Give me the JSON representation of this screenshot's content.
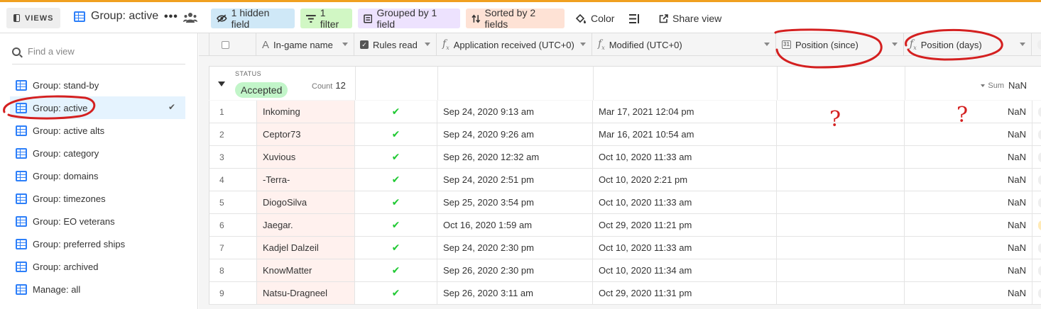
{
  "topbar": {
    "views_label": "VIEWS",
    "current_view": "Group: active",
    "more": "•••",
    "hidden_fields": "1 hidden field",
    "filter": "1 filter",
    "grouped": "Grouped by 1 field",
    "sorted": "Sorted by 2 fields",
    "color": "Color",
    "share": "Share view"
  },
  "sidebar": {
    "find_placeholder": "Find a view",
    "views": [
      {
        "label": "Group: stand-by"
      },
      {
        "label": "Group: active"
      },
      {
        "label": "Group: active alts"
      },
      {
        "label": "Group: category"
      },
      {
        "label": "Group: domains"
      },
      {
        "label": "Group: timezones"
      },
      {
        "label": "Group: EO veterans"
      },
      {
        "label": "Group: preferred ships"
      },
      {
        "label": "Group: archived"
      },
      {
        "label": "Manage: all"
      }
    ],
    "active_index": 1
  },
  "columns": {
    "name": "In-game name",
    "rules": "Rules read",
    "app": "Application received (UTC+0)",
    "mod": "Modified (UTC+0)",
    "since": "Position (since)",
    "days": "Position (days)",
    "since_icon": "31"
  },
  "group": {
    "field_label": "STATUS",
    "value": "Accepted",
    "badge_color": "#c2f5c9",
    "count_label": "Count",
    "count": "12",
    "sum_label": "Sum",
    "sum": "NaN"
  },
  "rows": [
    {
      "num": "1",
      "name": "Inkoming",
      "rules": true,
      "app": "Sep 24, 2020 9:13 am",
      "mod": "Mar 17, 2021 12:04 pm",
      "days": "NaN",
      "stub": "grey"
    },
    {
      "num": "2",
      "name": "Ceptor73",
      "rules": true,
      "app": "Sep 24, 2020 9:26 am",
      "mod": "Mar 16, 2021 10:54 am",
      "days": "NaN",
      "stub": "grey"
    },
    {
      "num": "3",
      "name": "Xuvious",
      "rules": true,
      "app": "Sep 26, 2020 12:32 am",
      "mod": "Oct 10, 2020 11:33 am",
      "days": "NaN",
      "stub": "grey"
    },
    {
      "num": "4",
      "name": "-Terra-",
      "rules": true,
      "app": "Sep 24, 2020 2:51 pm",
      "mod": "Oct 10, 2020 2:21 pm",
      "days": "NaN",
      "stub": "grey"
    },
    {
      "num": "5",
      "name": "DiogoSilva",
      "rules": true,
      "app": "Sep 25, 2020 3:54 pm",
      "mod": "Oct 10, 2020 11:33 am",
      "days": "NaN",
      "stub": "grey"
    },
    {
      "num": "6",
      "name": "Jaegar.",
      "rules": true,
      "app": "Oct 16, 2020 1:59 am",
      "mod": "Oct 29, 2020 11:21 pm",
      "days": "NaN",
      "stub": "yellow"
    },
    {
      "num": "7",
      "name": "Kadjel Dalzeil",
      "rules": true,
      "app": "Sep 24, 2020 2:30 pm",
      "mod": "Oct 10, 2020 11:33 am",
      "days": "NaN",
      "stub": "grey"
    },
    {
      "num": "8",
      "name": "KnowMatter",
      "rules": true,
      "app": "Sep 26, 2020 2:30 pm",
      "mod": "Oct 10, 2020 11:34 am",
      "days": "NaN",
      "stub": "grey"
    },
    {
      "num": "9",
      "name": "Natsu-Dragneel",
      "rules": true,
      "app": "Sep 26, 2020 3:11 am",
      "mod": "Oct 29, 2020 11:31 pm",
      "days": "NaN",
      "stub": "grey"
    }
  ],
  "annotations": {
    "mark": "?",
    "color": "#d42020"
  },
  "colors": {
    "accent": "#2d7ff9",
    "check_green": "#20c933",
    "name_cell_bg": "#fff1ee",
    "active_view_bg": "#e5f3fe"
  }
}
